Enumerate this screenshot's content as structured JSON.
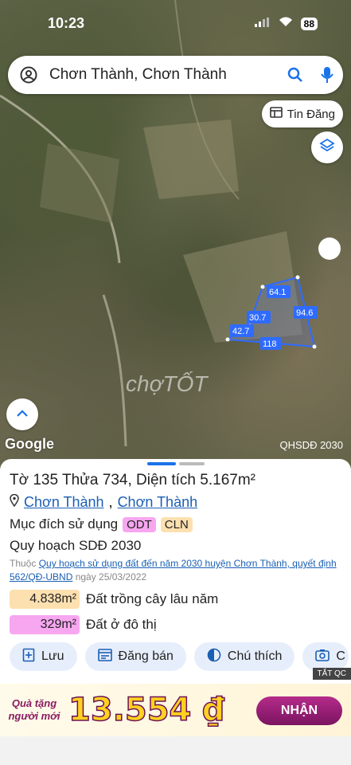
{
  "status": {
    "time": "10:23",
    "battery": "88"
  },
  "search": {
    "query": "Chơn Thành, Chơn Thành"
  },
  "map": {
    "tin_dang_label": "Tin Đăng",
    "edge_labels": {
      "top": "64.1",
      "right": "94.6",
      "inner": "30.7",
      "left": "42.7",
      "bottom": "118"
    },
    "watermark": "chợTỐT",
    "google_label": "Google",
    "layer_label": "QHSDĐ 2030"
  },
  "parcel": {
    "sheet_prefix": "Tờ",
    "sheet_no": "135",
    "parcel_prefix": "Thửa",
    "parcel_no": "734",
    "area_prefix": ", Diện tích",
    "area": "5.167m²",
    "location_1": "Chơn Thành",
    "location_sep": ",",
    "location_2": "Chơn Thành",
    "purpose_label": "Mục đích sử dụng",
    "tags": [
      "ODT",
      "CLN"
    ],
    "plan_label": "Quy hoạch SDĐ 2030",
    "belongs_prefix": "Thuộc",
    "belongs_link": "Quy hoạch sử dụng đất đến năm 2030 huyện Chơn Thành, quyết định 562/QĐ-UBND",
    "belongs_date": "ngày 25/03/2022",
    "areas": [
      {
        "value": "4.838m²",
        "label": "Đất trồng cây lâu năm",
        "color": "#fde0b0"
      },
      {
        "value": "329m²",
        "label": "Đất ở đô thị",
        "color": "#f7a6f0"
      }
    ]
  },
  "actions": {
    "save": "Lưu",
    "post": "Đăng bán",
    "legend": "Chú thích",
    "capture": "C"
  },
  "ad": {
    "tat_qc": "TẮT QC",
    "gift_line1": "Quà tặng",
    "gift_line2": "người mới",
    "amount": "13.554 ₫",
    "cta": "NHẬN"
  }
}
